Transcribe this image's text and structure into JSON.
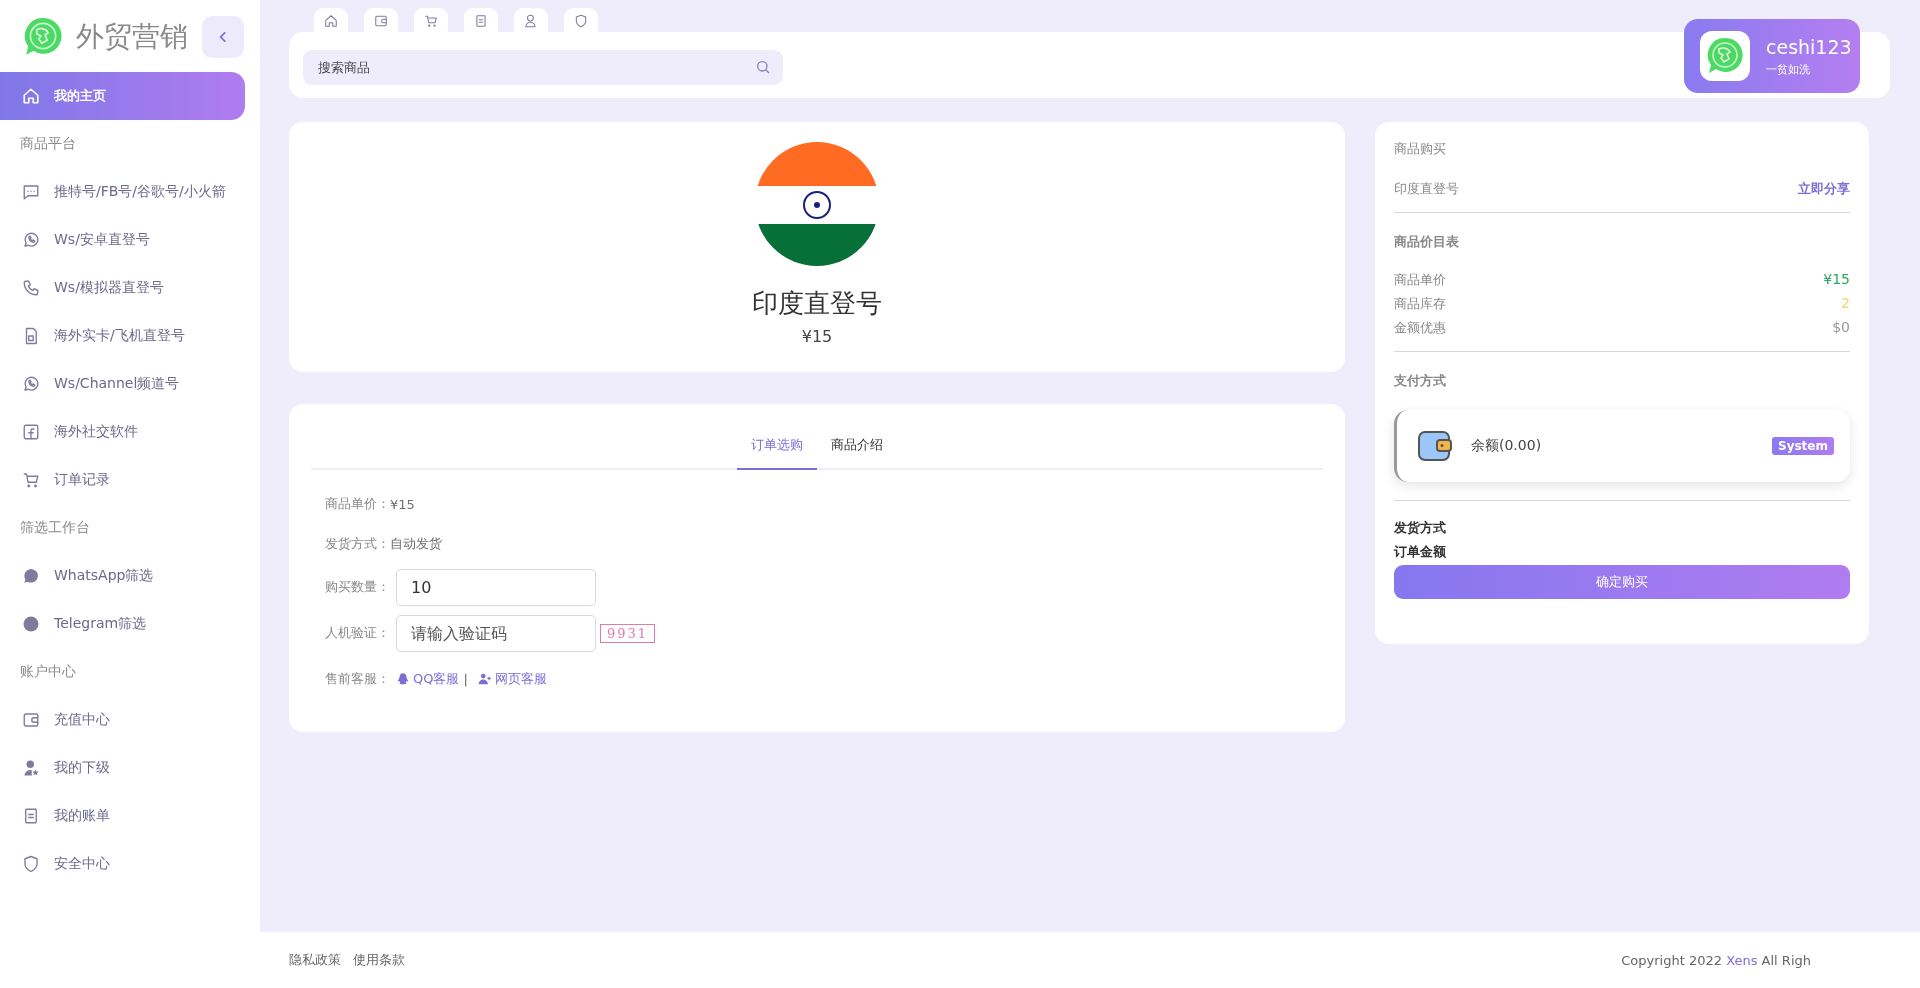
{
  "sidebar": {
    "brand": "外贸营销",
    "items": [
      {
        "kind": "link",
        "label": "我的主页",
        "selected": true
      },
      {
        "kind": "section",
        "label": "商品平台"
      },
      {
        "kind": "link",
        "label": "推特号/FB号/谷歌号/小火箭",
        "selected": false
      },
      {
        "kind": "link",
        "label": "Ws/安卓直登号",
        "selected": false
      },
      {
        "kind": "link",
        "label": "Ws/模拟器直登号",
        "selected": false
      },
      {
        "kind": "link",
        "label": "海外实卡/飞机直登号",
        "selected": false
      },
      {
        "kind": "link",
        "label": "Ws/Channel频道号",
        "selected": false
      },
      {
        "kind": "link",
        "label": "海外社交软件",
        "selected": false
      },
      {
        "kind": "link",
        "label": "订单记录",
        "selected": false
      },
      {
        "kind": "section",
        "label": "筛选工作台"
      },
      {
        "kind": "link",
        "label": "WhatsApp筛选",
        "selected": false
      },
      {
        "kind": "link",
        "label": "Telegram筛选",
        "selected": false
      },
      {
        "kind": "section",
        "label": "账户中心"
      },
      {
        "kind": "link",
        "label": "充值中心",
        "selected": false
      },
      {
        "kind": "link",
        "label": "我的下级",
        "selected": false
      },
      {
        "kind": "link",
        "label": "我的账单",
        "selected": false
      },
      {
        "kind": "link",
        "label": "安全中心",
        "selected": false
      }
    ]
  },
  "search": {
    "placeholder": "搜索商品"
  },
  "user": {
    "name": "ceshi123",
    "subtitle": "一贫如洗"
  },
  "product": {
    "title": "印度直登号",
    "price": "¥15"
  },
  "order": {
    "tabs": [
      {
        "label": "订单选购",
        "selected": true
      },
      {
        "label": "商品介绍",
        "selected": false
      }
    ],
    "rows": [
      {
        "kind": "text",
        "label": "商品单价：",
        "value": "¥15"
      },
      {
        "kind": "text",
        "label": "发货方式：",
        "value": "自动发货"
      },
      {
        "kind": "input",
        "label": "购买数量：",
        "value": "10"
      },
      {
        "kind": "captcha",
        "label": "人机验证：",
        "placeholder": "请输入验证码",
        "code": "9931"
      },
      {
        "kind": "links",
        "label": "售前客服：",
        "links": [
          "QQ客服",
          "网页客服"
        ],
        "separator": "|"
      }
    ]
  },
  "purchase": {
    "title": "商品购买",
    "product": "印度直登号",
    "share": "立即分享",
    "price_title": "商品价目表",
    "prices": [
      {
        "label": "商品单价",
        "value": "¥15",
        "color": "#2fa865"
      },
      {
        "label": "商品库存",
        "value": "2",
        "color": "#e6d96b"
      },
      {
        "label": "金额优惠",
        "value": "$0",
        "color": "#9a9a9a"
      }
    ],
    "payment_title": "支付方式",
    "payment": {
      "label": "余额(0.00)",
      "badge": "System"
    },
    "summary": [
      "发货方式",
      "订单金额"
    ],
    "button": "确定购买"
  },
  "footer": {
    "links": [
      "隐私政策",
      "使用条款"
    ],
    "copyright": "Copyright 2022 ",
    "brand": "Xens",
    "rights": " All Righ"
  }
}
